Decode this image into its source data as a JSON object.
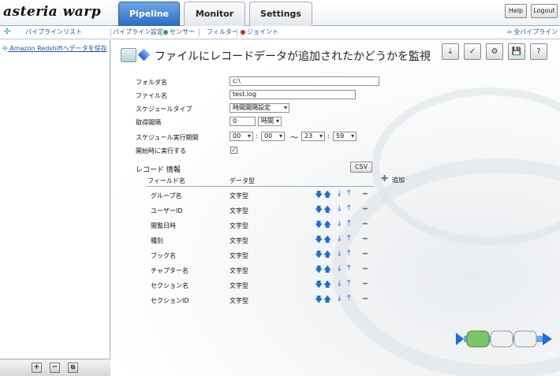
{
  "app": {
    "logo": "asteria warp",
    "tabs": [
      {
        "label": "Pipeline",
        "active": true
      },
      {
        "label": "Monitor",
        "active": false
      },
      {
        "label": "Settings",
        "active": false
      }
    ],
    "help_label": "Help",
    "logout_label": "Logout"
  },
  "subbar": {
    "pipeline_list": "パイプラインリスト",
    "pipeline_settings": "パイプライン設定",
    "sensor": "センサー",
    "filter": "フィルター",
    "joint": "ジョイント",
    "all_pipelines": "全パイプライン",
    "sensor_color": "#2aa84a",
    "joint_color": "#d22"
  },
  "sidebar": {
    "items": [
      {
        "label": "Amazon Redshiftへデータを保存"
      }
    ],
    "footer_buttons": [
      "+",
      "−",
      "⧉"
    ]
  },
  "main": {
    "title": "ファイルにレコードデータが追加されたかどうかを監視",
    "toolbar": [
      "⇣",
      "✓",
      "⚙",
      "💾",
      "?"
    ],
    "form": {
      "folder_label": "フォルダ名",
      "folder_value": "c:\\",
      "file_label": "ファイル名",
      "file_value": "test.log",
      "schedule_type_label": "スケジュールタイプ",
      "schedule_type_value": "時間間隔設定",
      "interval_label": "取得間隔",
      "interval_value": "0",
      "interval_unit": "時間",
      "period_label": "スケジュール実行期間",
      "period_start_h": "00",
      "period_start_m": "00",
      "period_sep": "～",
      "period_end_h": "23",
      "period_end_m": "59",
      "colon": ":",
      "run_on_start_label": "開始時に実行する",
      "run_on_start_checked": true
    },
    "record": {
      "section_label": "レコード 情報",
      "csv_label": "CSV",
      "add_label": "追加",
      "col_field": "フィールド名",
      "col_type": "データ型",
      "rows": [
        {
          "field": "グループ名",
          "type": "文字型"
        },
        {
          "field": "ユーザーID",
          "type": "文字型"
        },
        {
          "field": "閲覧日時",
          "type": "文字型"
        },
        {
          "field": "種別",
          "type": "文字型"
        },
        {
          "field": "ブック名",
          "type": "文字型"
        },
        {
          "field": "チャプター名",
          "type": "文字型"
        },
        {
          "field": "セクション名",
          "type": "文字型"
        },
        {
          "field": "セクションID",
          "type": "文字型"
        }
      ]
    }
  }
}
